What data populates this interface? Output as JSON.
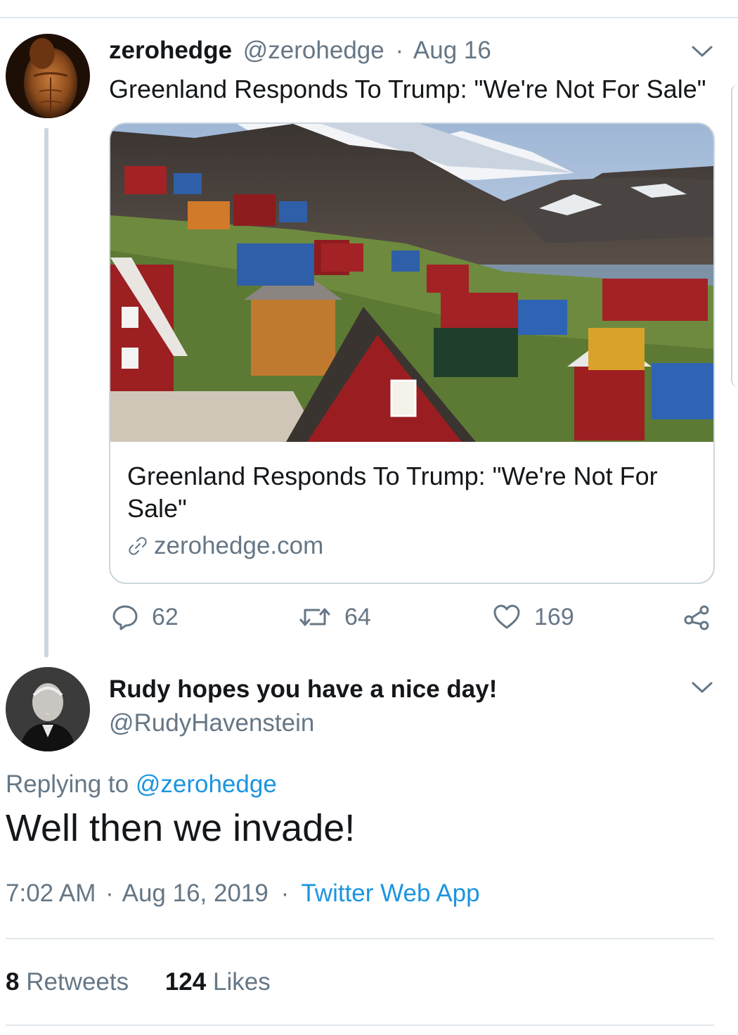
{
  "tweet1": {
    "display_name": "zerohedge",
    "handle": "@zerohedge",
    "separator": "·",
    "date": "Aug 16",
    "text": "Greenland Responds To Trump: \"We're Not For Sale\"",
    "avatar_icon": "shirtless-man-avatar",
    "card": {
      "image_icon": "greenland-village-photo",
      "title": "Greenland Responds To Trump: \"We're Not For Sale\"",
      "domain": "zerohedge.com",
      "link_icon": "link-icon"
    },
    "actions": {
      "replies": "62",
      "retweets": "64",
      "likes": "169"
    }
  },
  "tweet2": {
    "display_name": "Rudy hopes you have a nice day!",
    "handle": "@RudyHavenstein",
    "avatar_icon": "old-man-portrait-avatar",
    "replying_prefix": "Replying to",
    "replying_handle": "@zerohedge",
    "text": "Well then we invade!",
    "time": "7:02 AM",
    "sep1": "·",
    "date": "Aug 16, 2019",
    "sep2": "·",
    "client": "Twitter Web App",
    "retweets_count": "8",
    "retweets_label": "Retweets",
    "likes_count": "124",
    "likes_label": "Likes"
  },
  "colors": {
    "text": "#14171a",
    "muted": "#657786",
    "link": "#1b95e0",
    "border": "#e1e8ed",
    "thread": "#ccd6dd"
  }
}
